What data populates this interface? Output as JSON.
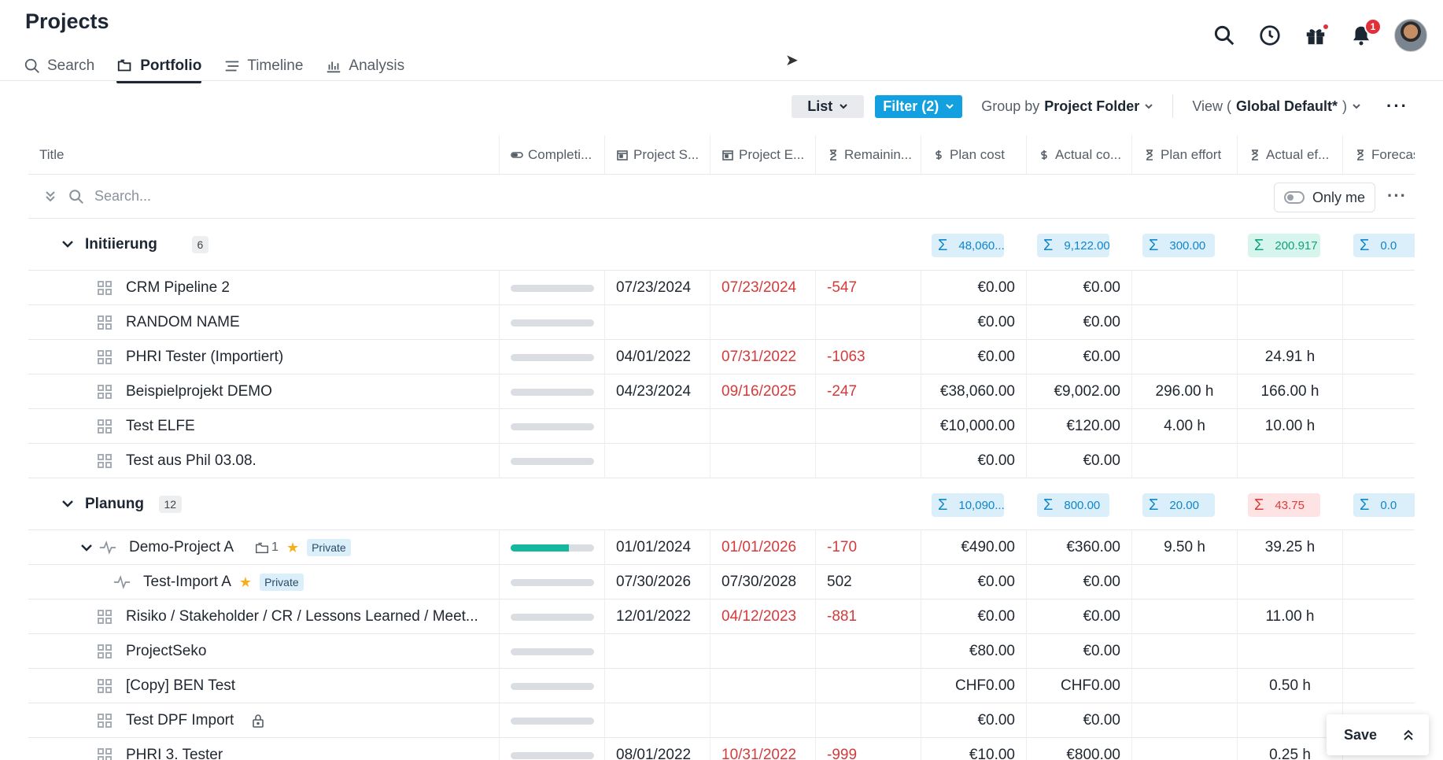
{
  "app": {
    "title": "Projects"
  },
  "tabs": [
    {
      "label": "Search",
      "icon": "search-icon"
    },
    {
      "label": "Portfolio",
      "icon": "folder-icon",
      "active": true
    },
    {
      "label": "Timeline",
      "icon": "timeline-icon"
    },
    {
      "label": "Analysis",
      "icon": "bar-chart-icon"
    }
  ],
  "header_icons": {
    "notification_count": "1"
  },
  "toolbar": {
    "list_label": "List",
    "filter_label": "Filter (2)",
    "group_prefix": "Group by",
    "group_value": "Project Folder",
    "view_prefix": "View (",
    "view_value": "Global Default*",
    "view_suffix": ")"
  },
  "columns": [
    "Title",
    "Completi...",
    "Project S...",
    "Project E...",
    "Remainin...",
    "Plan cost",
    "Actual co...",
    "Plan effort",
    "Actual ef...",
    "Forecas"
  ],
  "search": {
    "placeholder": "Search...",
    "only_me_label": "Only me"
  },
  "groups": [
    {
      "name": "Initiierung",
      "count": "6",
      "sums": {
        "plan_cost": "48,060...",
        "actual_cost": "9,122.00",
        "plan_effort": "300.00",
        "actual_effort": "200.917",
        "forecast": "0.0"
      },
      "rows": [
        {
          "title": "CRM Pipeline 2",
          "progress": 0,
          "start": "07/23/2024",
          "end": "07/23/2024",
          "remaining": "-547",
          "plan_cost": "€0.00",
          "actual_cost": "€0.00",
          "plan_effort": "",
          "actual_effort": ""
        },
        {
          "title": "RANDOM NAME",
          "progress": 0,
          "start": "",
          "end": "",
          "remaining": "",
          "plan_cost": "€0.00",
          "actual_cost": "€0.00",
          "plan_effort": "",
          "actual_effort": ""
        },
        {
          "title": "PHRI Tester (Importiert)",
          "progress": 0,
          "start": "04/01/2022",
          "end": "07/31/2022",
          "remaining": "-1063",
          "plan_cost": "€0.00",
          "actual_cost": "€0.00",
          "plan_effort": "",
          "actual_effort": "24.91 h"
        },
        {
          "title": "Beispielprojekt DEMO",
          "progress": 0,
          "start": "04/23/2024",
          "end": "09/16/2025",
          "remaining": "-247",
          "plan_cost": "€38,060.00",
          "actual_cost": "€9,002.00",
          "plan_effort": "296.00 h",
          "actual_effort": "166.00 h"
        },
        {
          "title": "Test ELFE",
          "progress": 0,
          "start": "",
          "end": "",
          "remaining": "",
          "plan_cost": "€10,000.00",
          "actual_cost": "€120.00",
          "plan_effort": "4.00 h",
          "actual_effort": "10.00 h"
        },
        {
          "title": "Test aus Phil 03.08.",
          "progress": 0,
          "start": "",
          "end": "",
          "remaining": "",
          "plan_cost": "€0.00",
          "actual_cost": "€0.00",
          "plan_effort": "",
          "actual_effort": ""
        }
      ]
    },
    {
      "name": "Planung",
      "count": "12",
      "sums": {
        "plan_cost": "10,090...",
        "actual_cost": "800.00",
        "plan_effort": "20.00",
        "actual_effort": "43.75",
        "forecast": "0.0"
      },
      "rows": [
        {
          "title": "Demo-Project A",
          "progress": 0.7,
          "start": "01/01/2024",
          "end": "01/01/2026",
          "remaining": "-170",
          "plan_cost": "€490.00",
          "actual_cost": "€360.00",
          "plan_effort": "9.50 h",
          "actual_effort": "39.25 h",
          "subcount": "1",
          "badge": "Private"
        },
        {
          "title": "Test-Import A",
          "progress": 0,
          "start": "07/30/2026",
          "end": "07/30/2028",
          "remaining": "502",
          "plan_cost": "€0.00",
          "actual_cost": "€0.00",
          "plan_effort": "",
          "actual_effort": "",
          "badge": "Private"
        },
        {
          "title": "Risiko / Stakeholder / CR / Lessons Learned / Meet...",
          "progress": 0,
          "start": "12/01/2022",
          "end": "04/12/2023",
          "remaining": "-881",
          "plan_cost": "€0.00",
          "actual_cost": "€0.00",
          "plan_effort": "",
          "actual_effort": "11.00 h"
        },
        {
          "title": "ProjectSeko",
          "progress": 0,
          "start": "",
          "end": "",
          "remaining": "",
          "plan_cost": "€80.00",
          "actual_cost": "€0.00",
          "plan_effort": "",
          "actual_effort": ""
        },
        {
          "title": "[Copy] BEN Test",
          "progress": 0,
          "start": "",
          "end": "",
          "remaining": "",
          "plan_cost": "CHF0.00",
          "actual_cost": "CHF0.00",
          "plan_effort": "",
          "actual_effort": "0.50 h"
        },
        {
          "title": "Test DPF Import",
          "progress": 0,
          "start": "",
          "end": "",
          "remaining": "",
          "plan_cost": "€0.00",
          "actual_cost": "€0.00",
          "plan_effort": "",
          "actual_effort": ""
        },
        {
          "title": "PHRI 3. Tester",
          "progress": 0,
          "start": "08/01/2022",
          "end": "10/31/2022",
          "remaining": "-999",
          "plan_cost": "€10.00",
          "actual_cost": "€800.00",
          "plan_effort": "",
          "actual_effort": "0.25 h"
        }
      ]
    }
  ],
  "save": {
    "label": "Save"
  },
  "colors": {
    "accent": "#12a0e0",
    "progress": "#14b89e",
    "overdue": "#d63a3a",
    "star": "#f4b01a"
  }
}
